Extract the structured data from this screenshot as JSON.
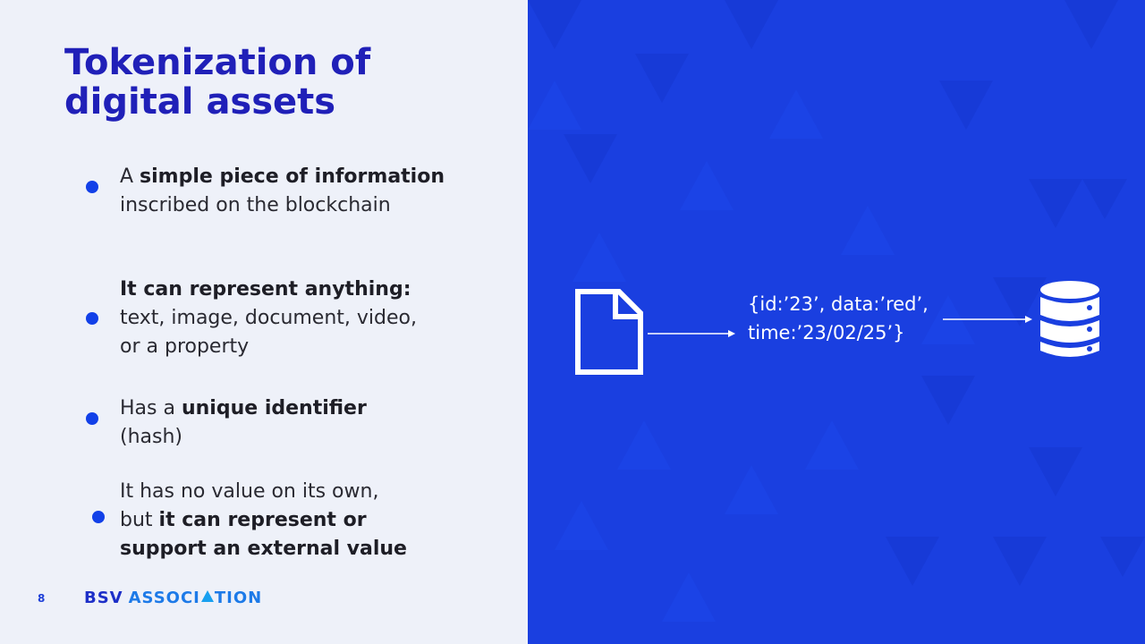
{
  "slide": {
    "title": "Tokenization of digital assets",
    "bullets": [
      {
        "parts": [
          {
            "text": "A ",
            "bold": false
          },
          {
            "text": "simple piece of information",
            "bold": true
          },
          {
            "text": " inscribed on the blockchain",
            "bold": false
          }
        ]
      },
      {
        "parts": [
          {
            "text": "It can represent anything:",
            "bold": true
          },
          {
            "text": " text, image, document, video, or a property",
            "bold": false
          }
        ]
      },
      {
        "parts": [
          {
            "text": "Has a ",
            "bold": false
          },
          {
            "text": "unique identifier",
            "bold": true
          },
          {
            "text": " (hash)",
            "bold": false
          }
        ]
      },
      {
        "parts": [
          {
            "text": "It has no value on its own, but ",
            "bold": false
          },
          {
            "text": "it can represent or support an external value",
            "bold": true
          }
        ]
      }
    ],
    "page_number": "8",
    "logo": {
      "part1": "BSV",
      "part2a": "ASSOCI",
      "part2b": "TION"
    }
  },
  "diagram": {
    "record_line1": "{id:’23’, data:’red’,",
    "record_line2": "time:’23/02/25’}",
    "icons": [
      "document-icon",
      "arrow-right-icon",
      "database-icon"
    ]
  },
  "colors": {
    "title": "#2020b8",
    "accent": "#1240e8",
    "panel": "#1a3fe0",
    "left_bg": "#eef1f9"
  }
}
